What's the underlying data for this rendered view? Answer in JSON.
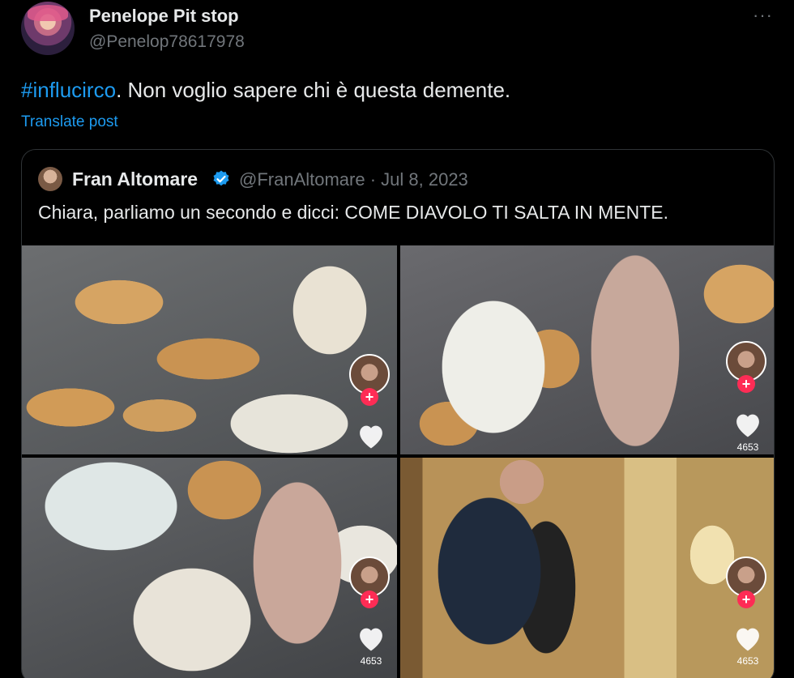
{
  "tweet": {
    "author_name": "Penelope Pit stop",
    "author_handle": "@Penelop78617978",
    "more_label": "···",
    "hashtag": "#influcirco",
    "text_rest": ". Non voglio sapere chi è questa demente.",
    "translate_label": "Translate post"
  },
  "quote": {
    "author_name": "Fran Altomare",
    "handle_and_date": "@FranAltomare · Jul 8, 2023",
    "text": "Chiara, parliamo un secondo e dicci: COME DIAVOLO TI SALTA IN MENTE.",
    "verified_color": "#1d9bf0"
  },
  "media": {
    "tiles": [
      {
        "like_count": ""
      },
      {
        "like_count": "4653"
      },
      {
        "like_count": "4653"
      },
      {
        "like_count": "4653"
      }
    ],
    "plus_symbol": "+"
  },
  "colors": {
    "accent": "#1d9bf0",
    "secondary_text": "#71767b",
    "tiktok_red": "#fe2c55"
  }
}
